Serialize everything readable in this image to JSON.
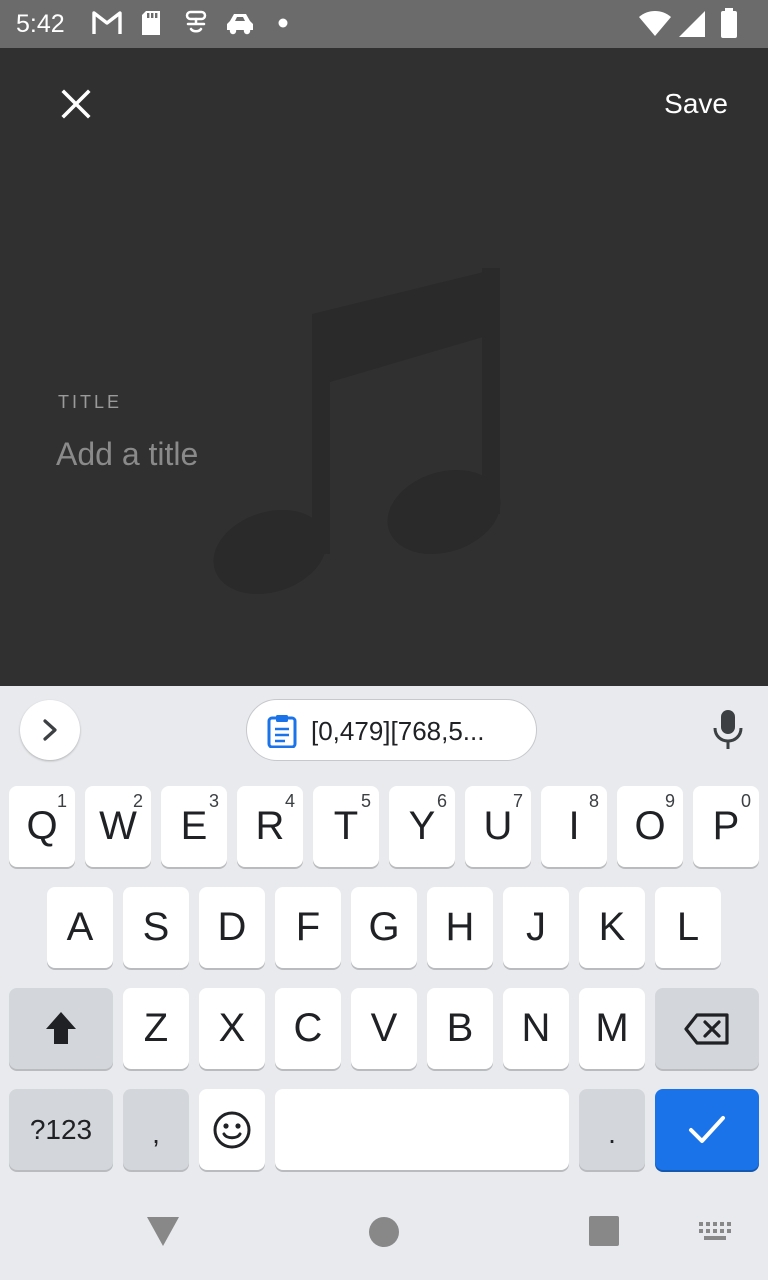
{
  "status_bar": {
    "time": "5:42",
    "left_icons": [
      "gmail-icon",
      "sd-card-icon",
      "accessibility-icon",
      "car-icon",
      "dot-icon"
    ],
    "right_icons": [
      "wifi-icon",
      "signal-icon",
      "battery-icon"
    ]
  },
  "app": {
    "close_icon": "close-icon",
    "save_label": "Save",
    "art_icon": "music-note-icon",
    "title_label": "TITLE",
    "title_placeholder": "Add a title",
    "title_value": ""
  },
  "keyboard": {
    "clipboard_chip_text": "[0,479][768,5...",
    "row1": [
      {
        "key": "Q",
        "hint": "1"
      },
      {
        "key": "W",
        "hint": "2"
      },
      {
        "key": "E",
        "hint": "3"
      },
      {
        "key": "R",
        "hint": "4"
      },
      {
        "key": "T",
        "hint": "5"
      },
      {
        "key": "Y",
        "hint": "6"
      },
      {
        "key": "U",
        "hint": "7"
      },
      {
        "key": "I",
        "hint": "8"
      },
      {
        "key": "O",
        "hint": "9"
      },
      {
        "key": "P",
        "hint": "0"
      }
    ],
    "row2": [
      "A",
      "S",
      "D",
      "F",
      "G",
      "H",
      "J",
      "K",
      "L"
    ],
    "row3": [
      "Z",
      "X",
      "C",
      "V",
      "B",
      "N",
      "M"
    ],
    "symbols_label": "?123",
    "comma_label": ",",
    "period_label": ".",
    "space_label": "",
    "accent_color": "#1a73e8"
  },
  "nav_bar": {
    "icons": [
      "back-icon",
      "home-icon",
      "recents-icon",
      "keyboard-switch-icon"
    ]
  }
}
